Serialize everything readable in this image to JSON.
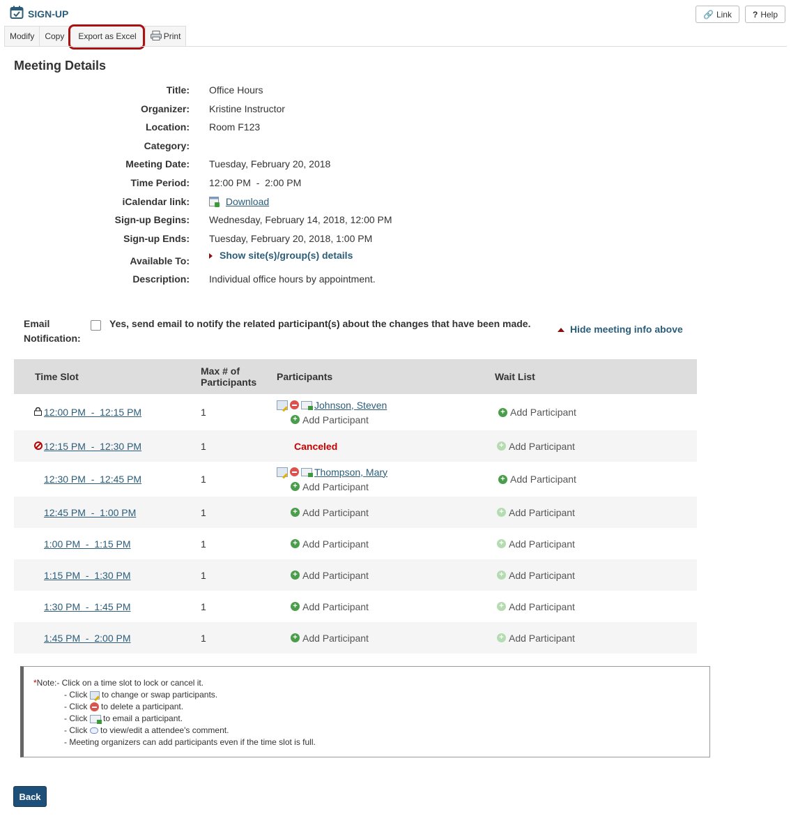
{
  "header": {
    "tool_title": "SIGN-UP",
    "link_label": "Link",
    "help_label": "Help"
  },
  "toolbar": {
    "modify": "Modify",
    "copy": "Copy",
    "export": "Export as Excel",
    "print": "Print"
  },
  "section_title": "Meeting Details",
  "details": {
    "title_label": "Title:",
    "title": "Office Hours",
    "organizer_label": "Organizer:",
    "organizer": "Kristine Instructor",
    "location_label": "Location:",
    "location": "Room F123",
    "category_label": "Category:",
    "category": "",
    "date_label": "Meeting Date:",
    "date": "Tuesday, February 20, 2018",
    "time_label": "Time Period:",
    "time": "12:00 PM  -  2:00 PM",
    "ical_label": "iCalendar link:",
    "ical": "Download",
    "begins_label": "Sign-up Begins:",
    "begins": "Wednesday, February 14, 2018, 12:00 PM",
    "ends_label": "Sign-up Ends:",
    "ends": "Tuesday, February 20, 2018, 1:00 PM",
    "avail_label": "Available To:",
    "avail": "Show site(s)/group(s) details",
    "desc_label": "Description:",
    "desc": "Individual office hours by appointment."
  },
  "email": {
    "label_line1": "Email",
    "label_line2": "Notification:",
    "text": "Yes, send email to notify the related participant(s) about the changes that have been made.",
    "hide_link": "Hide meeting info above"
  },
  "table": {
    "headers": {
      "slot": "Time Slot",
      "max_line1": "Max # of",
      "max_line2": "Participants",
      "participants": "Participants",
      "waitlist": "Wait List"
    },
    "add_label": "Add Participant",
    "canceled_label": "Canceled",
    "rows": [
      {
        "slot": "12:00 PM  -  12:15 PM",
        "max": "1",
        "participant": "Johnson, Steven"
      },
      {
        "slot": "12:15 PM  -  12:30 PM",
        "max": "1"
      },
      {
        "slot": "12:30 PM  -  12:45 PM",
        "max": "1",
        "participant": "Thompson, Mary"
      },
      {
        "slot": "12:45 PM  -  1:00 PM",
        "max": "1"
      },
      {
        "slot": "1:00 PM  -  1:15 PM",
        "max": "1"
      },
      {
        "slot": "1:15 PM  -  1:30 PM",
        "max": "1"
      },
      {
        "slot": "1:30 PM  -  1:45 PM",
        "max": "1"
      },
      {
        "slot": "1:45 PM  -  2:00 PM",
        "max": "1"
      }
    ]
  },
  "note": {
    "star": "*",
    "line1": "Note:- Click on a time slot to lock or cancel it.",
    "line2a": "- Click",
    "line2b": "to change or swap participants.",
    "line3a": "- Click",
    "line3b": "to delete a participant.",
    "line4a": "- Click",
    "line4b": "to email a participant.",
    "line5a": "- Click",
    "line5b": "to view/edit a attendee's comment.",
    "line6": "- Meeting organizers can add participants even if the time slot is full."
  },
  "back_label": "Back"
}
